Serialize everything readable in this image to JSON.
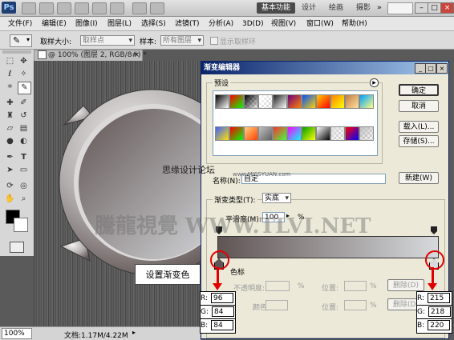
{
  "app": {
    "logo": "Ps",
    "workspaces": [
      "基本功能",
      "设计",
      "绘画",
      "摄影"
    ],
    "more": "»"
  },
  "menu": [
    "文件(F)",
    "编辑(E)",
    "图像(I)",
    "图层(L)",
    "选择(S)",
    "滤镜(T)",
    "分析(A)",
    "3D(D)",
    "视图(V)",
    "窗口(W)",
    "帮助(H)"
  ],
  "options": {
    "sample_size_label": "取样大小:",
    "sample_size_value": "取样点",
    "sample_label": "样本:",
    "sample_value": "所有图层",
    "show_ring_label": "显示取样环"
  },
  "document": {
    "tab_title": "@ 100% (图层 2, RGB/8#) *",
    "zoom": "100%",
    "doc_info": "文档:1.17M/4.22M"
  },
  "dialog": {
    "title": "渐变编辑器",
    "presets_label": "预设",
    "ok": "确定",
    "cancel": "取消",
    "load": "载入(L)...",
    "save": "存储(S)...",
    "name_label": "名称(N):",
    "name_value": "自定",
    "new_button": "新建(W)",
    "type_label": "渐变类型(T):",
    "type_value": "实底",
    "smooth_label": "平滑度(M):",
    "smooth_value": "100",
    "smooth_unit": "%",
    "stops_label": "色标",
    "opacity_label": "不透明度:",
    "color_label": "颜色:",
    "location_label": "位置:",
    "percent": "%",
    "delete": "删除(D)"
  },
  "annotation": {
    "callout": "设置渐变色",
    "left_stop": {
      "r_label": "R:",
      "r": "96",
      "g_label": "G:",
      "g": "84",
      "b_label": "B:",
      "b": "84"
    },
    "right_stop": {
      "r_label": "R:",
      "r": "215",
      "g_label": "G:",
      "g": "218",
      "b_label": "B:",
      "b": "220"
    }
  },
  "watermarks": {
    "forum": "思缘设计论坛",
    "site": "www.MISSYUAN.com",
    "brand": "騰龍視覺 WWW.TLVI.NET"
  },
  "colors": {
    "gradient_start": "#605454",
    "gradient_end": "#d7dadc",
    "accent_red": "#e00000",
    "title_blue": "#0a246a"
  },
  "presets": [
    "#000000,#ffffff",
    "#ff0000,#00ff00",
    "#000000,transparent",
    "#ffffff,transparent",
    "#202020,#ffffff",
    "#6a0080,#ff8000",
    "#0050ff,#ffd000",
    "#ffcc00,#ff0000",
    "#ff8000,#ffff00",
    "#c08040,#ffe0a0",
    "#00a0ff,#ffff80",
    "#4060ff,#ffe000",
    "#ff0000,#00ff00",
    "#ffd080,#ff4000",
    "#c0c0c0,#606060",
    "#ff3030,#40ff40",
    "#ff00ff,#00ffff",
    "#00a000,#ffff00",
    "#ffffff,#000000",
    "#e0e0e0,transparent",
    "#ff0000,#0000ff",
    "#c0c0c0,transparent"
  ]
}
